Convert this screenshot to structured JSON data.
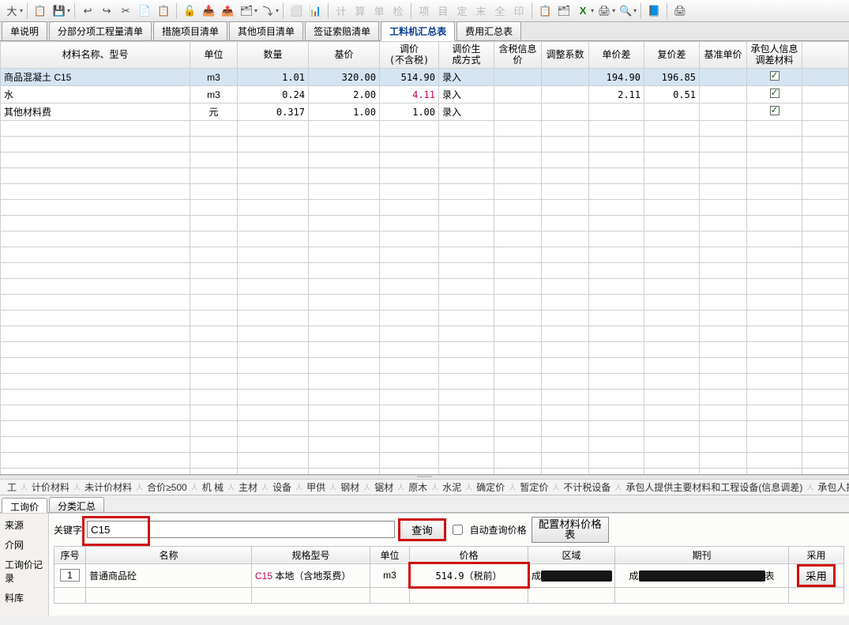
{
  "toolbar_hints": [
    "大",
    "📋",
    "💾",
    "↩",
    "↪",
    "✂",
    "📄",
    "📋",
    "🔓",
    "📥",
    "📤",
    "🗂",
    "⤵",
    "⬜",
    "📊",
    "计",
    "算",
    "单",
    "检",
    "项",
    "目",
    "定",
    "末",
    "全",
    "印",
    "📋",
    "🗂",
    "X",
    "🖨",
    "🔍",
    "📘",
    "🖨"
  ],
  "tabs": [
    {
      "label": "单说明"
    },
    {
      "label": "分部分项工程量清单"
    },
    {
      "label": "措施项目清单"
    },
    {
      "label": "其他项目清单"
    },
    {
      "label": "签证索赔清单"
    },
    {
      "label": "工料机汇总表",
      "active": true
    },
    {
      "label": "费用汇总表"
    }
  ],
  "grid": {
    "headers": [
      "材料名称、型号",
      "单位",
      "数量",
      "基价",
      "调价\n(不含税)",
      "调价生\n成方式",
      "含税信息\n价",
      "调整系数",
      "单价差",
      "复价差",
      "基准单价",
      "承包人信息\n调差材料"
    ],
    "rows": [
      {
        "name": "商品混凝土 C15",
        "unit": "m3",
        "qty": "1.01",
        "base": "320.00",
        "adj": "514.90",
        "gen": "录入",
        "tax": "",
        "coef": "",
        "d1": "194.90",
        "d2": "196.85",
        "bench": "",
        "owner": true,
        "selected": true
      },
      {
        "name": "水",
        "unit": "m3",
        "qty": "0.24",
        "base": "2.00",
        "adj": "4.11",
        "adj_red": true,
        "gen": "录入",
        "d1": "2.11",
        "d2": "0.51",
        "owner": true
      },
      {
        "name": "其他材料费",
        "unit": "元",
        "qty": "0.317",
        "base": "1.00",
        "adj": "1.00",
        "gen": "录入",
        "owner": true
      }
    ]
  },
  "mid_tabs": [
    "工",
    "计价材料",
    "未计价材料",
    "合价≥500",
    "机 械",
    "主材",
    "设备",
    "甲供",
    "钢材",
    "锯材",
    "原木",
    "水泥",
    "确定价",
    "暂定价",
    "不计税设备",
    "承包人提供主要材料和工程设备(信息调差)",
    "承包人提供主要材料"
  ],
  "sub_tabs": [
    {
      "label": "工询价",
      "active": true
    },
    {
      "label": "分类汇总"
    }
  ],
  "side_nav": [
    "来源",
    "介网",
    "工询价记录",
    "料库"
  ],
  "search": {
    "kw_label": "关键字",
    "kw_value": "C15",
    "btn_query": "查询",
    "auto_label": "自动查询价格",
    "btn_config": "配置材料价格\n表"
  },
  "result": {
    "headers": [
      "序号",
      "名称",
      "规格型号",
      "单位",
      "价格",
      "区域",
      "期刊",
      "采用"
    ],
    "row": {
      "num": "1",
      "name": "普通商品砼",
      "spec_prefix": "C15 ",
      "spec_rest": "本地（含地泵费）",
      "unit": "m3",
      "price": "514.9（税前）",
      "area_prefix": "成",
      "period_prefix": "成",
      "period_suffix": "表",
      "use_btn": "采用"
    }
  }
}
